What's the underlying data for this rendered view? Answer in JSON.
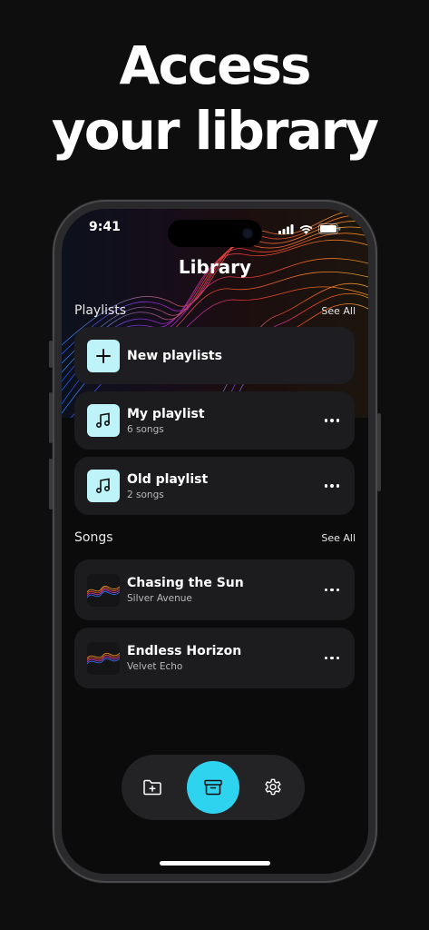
{
  "headline": {
    "line1": "Access",
    "line2": "your library"
  },
  "status_bar": {
    "time": "9:41",
    "icons": [
      "signal-icon",
      "wifi-icon",
      "battery-icon"
    ]
  },
  "screen": {
    "title": "Library"
  },
  "playlists_section": {
    "title": "Playlists",
    "see_all": "See All",
    "new_playlist_label": "New playlists",
    "items": [
      {
        "name": "My playlist",
        "count": "6 songs"
      },
      {
        "name": "Old playlist",
        "count": "2 songs"
      }
    ]
  },
  "songs_section": {
    "title": "Songs",
    "see_all": "See All",
    "items": [
      {
        "title": "Chasing the Sun",
        "artist": "Silver Avenue"
      },
      {
        "title": "Endless Horizon",
        "artist": "Velvet Echo"
      }
    ]
  },
  "tab_bar": {
    "tabs": [
      {
        "icon": "folder-plus-icon",
        "active": false
      },
      {
        "icon": "archive-icon",
        "active": true
      },
      {
        "icon": "gear-icon",
        "active": false
      }
    ]
  },
  "colors": {
    "accent": "#2ED3EF",
    "thumb_bg": "#BFF3FA",
    "card_bg": "#1C1C1F",
    "page_bg": "#0E0E0E"
  }
}
